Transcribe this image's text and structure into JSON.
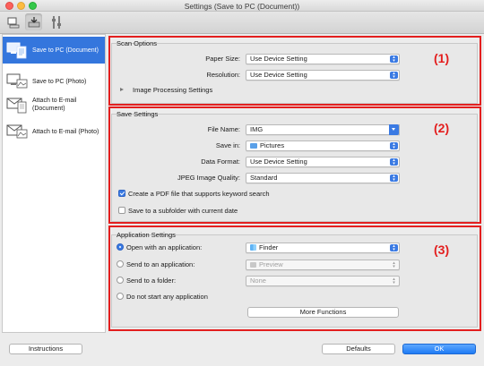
{
  "window": {
    "title": "Settings (Save to PC (Document))"
  },
  "toolbar": {
    "buttons": [
      "scan-from-computer-icon",
      "scan-from-operation-panel-icon",
      "general-settings-icon"
    ]
  },
  "sidebar": {
    "items": [
      {
        "label": "Save to PC (Document)",
        "icon": "save-document-icon",
        "selected": true
      },
      {
        "label": "Save to PC (Photo)",
        "icon": "save-photo-icon",
        "selected": false
      },
      {
        "label": "Attach to E-mail (Document)",
        "icon": "email-document-icon",
        "selected": false
      },
      {
        "label": "Attach to E-mail (Photo)",
        "icon": "email-photo-icon",
        "selected": false
      }
    ]
  },
  "scan_options": {
    "title": "Scan Options",
    "paper_size_label": "Paper Size:",
    "paper_size_value": "Use Device Setting",
    "resolution_label": "Resolution:",
    "resolution_value": "Use Device Setting",
    "image_processing_label": "Image Processing Settings"
  },
  "save_settings": {
    "title": "Save Settings",
    "file_name_label": "File Name:",
    "file_name_value": "IMG",
    "save_in_label": "Save in:",
    "save_in_value": "Pictures",
    "data_format_label": "Data Format:",
    "data_format_value": "Use Device Setting",
    "jpeg_quality_label": "JPEG Image Quality:",
    "jpeg_quality_value": "Standard",
    "pdf_keyword_label": "Create a PDF file that supports keyword search",
    "pdf_keyword_checked": true,
    "subfolder_label": "Save to a subfolder with current date",
    "subfolder_checked": false
  },
  "application_settings": {
    "title": "Application Settings",
    "open_app_label": "Open with an application:",
    "open_app_value": "Finder",
    "send_app_label": "Send to an application:",
    "send_app_value": "Preview",
    "send_folder_label": "Send to a folder:",
    "send_folder_value": "None",
    "no_app_label": "Do not start any application",
    "more_functions_label": "More Functions",
    "selected_option": "open_app"
  },
  "annotations": {
    "n1": "(1)",
    "n2": "(2)",
    "n3": "(3)",
    "color": "#e31e1e"
  },
  "footer": {
    "instructions_label": "Instructions",
    "defaults_label": "Defaults",
    "ok_label": "OK"
  },
  "colors": {
    "accent": "#3a7ae3",
    "selection": "#3476dd"
  }
}
